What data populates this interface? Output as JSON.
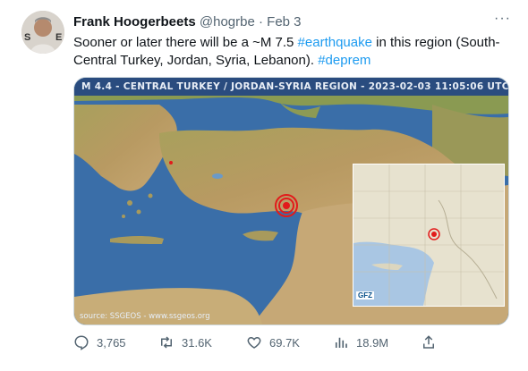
{
  "tweet": {
    "display_name": "Frank Hoogerbeets",
    "handle": "@hogrbe",
    "separator": "·",
    "date": "Feb 3",
    "text_part1": "Sooner or later there will be a ~M 7.5 ",
    "hashtag1": "#earthquake",
    "text_part2": " in this region (South-Central Turkey, Jordan, Syria, Lebanon). ",
    "hashtag2": "#deprem",
    "more_label": "···"
  },
  "media": {
    "map_title": "M 4.4 - CENTRAL TURKEY / JORDAN-SYRIA REGION - 2023-02-03 11:05:06 UTC",
    "source": "source: SSGEOS - www.ssgeos.org",
    "inset_logo": "GFZ"
  },
  "actions": {
    "replies": "3,765",
    "retweets": "31.6K",
    "likes": "69.7K",
    "views": "18.9M"
  },
  "colors": {
    "accent": "#1d9bf0",
    "secondary_text": "#536471",
    "sea": "#3a6ea8"
  }
}
